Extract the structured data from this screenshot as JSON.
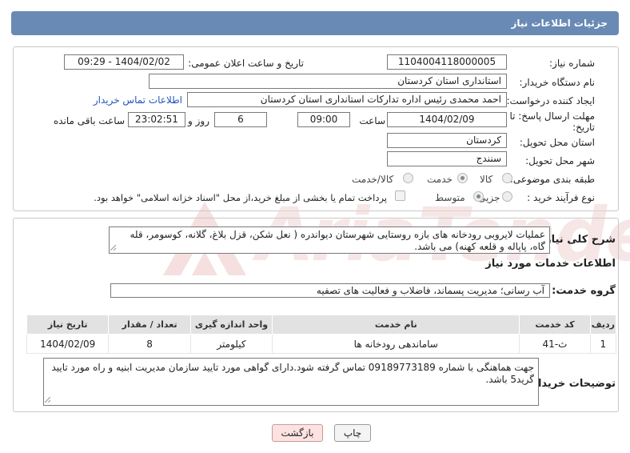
{
  "header": {
    "title": "جزئیات اطلاعات نیاز"
  },
  "watermark": {
    "text": "AriaTender.neT"
  },
  "fields": {
    "need_number_label": "شماره نیاز:",
    "need_number": "1104004118000005",
    "announce_label": "تاریخ و ساعت اعلان عمومی:",
    "announce_value": "1404/02/02 - 09:29",
    "buyer_org_label": "نام دستگاه خریدار:",
    "buyer_org": "استانداری استان کردستان",
    "creator_label": "ایجاد کننده درخواست:",
    "creator": "احمد محمدی رئیس اداره تدارکات استانداری استان کردستان",
    "contact_link": "اطلاعات تماس خریدار",
    "deadline_label_1": "مهلت ارسال پاسخ: تا",
    "deadline_label_2": "تاریخ:",
    "deadline_date": "1404/02/09",
    "time_label": "ساعت",
    "deadline_time": "09:00",
    "days_value": "6",
    "days_label": "روز و",
    "remaining_time": "23:02:51",
    "remaining_label": "ساعت باقی مانده",
    "province_label": "استان محل تحویل:",
    "province": "کردستان",
    "city_label": "شهر محل تحویل:",
    "city": "سنندج",
    "category_label": "طبقه بندی موضوعی:",
    "category_options": [
      "کالا",
      "خدمت",
      "کالا/خدمت"
    ],
    "category_selected": "خدمت",
    "process_label": "نوع فرآیند خرید :",
    "process_options": [
      "جزیی",
      "متوسط"
    ],
    "process_selected": "متوسط",
    "payment_note": "پرداخت تمام یا بخشی از مبلغ خرید،از محل \"اسناد خزانه اسلامی\" خواهد بود."
  },
  "summary": {
    "label": "شرح کلی نیاز:",
    "text": "عملیات لایروبی رودخانه های بازه روستایی شهرستان دیواندره ( نعل شکن، قزل بلاغ، گلانه، کوسومر، قله گاه، پاپاله و قلعه کهنه) می باشد."
  },
  "services_info": {
    "title": "اطلاعات خدمات مورد نیاز",
    "group_label": "گروه خدمت:",
    "group_value": "آب رسانی؛ مدیریت پسماند، فاضلاب و فعالیت های تصفیه"
  },
  "table": {
    "headers": [
      "ردیف",
      "کد خدمت",
      "نام خدمت",
      "واحد اندازه گیری",
      "تعداد / مقدار",
      "تاریخ نیاز"
    ],
    "rows": [
      [
        "1",
        "ث-41",
        "ساماندهی رودخانه ها",
        "کیلومتر",
        "8",
        "1404/02/09"
      ]
    ]
  },
  "buyer_notes": {
    "label": "توضیحات خریدار:",
    "text": "جهت هماهنگی با شماره 09189773189 تماس گرفته شود.دارای گواهی مورد تایید سازمان مدیریت ابنیه و راه مورد تایید گرید5 باشد."
  },
  "buttons": {
    "print": "چاپ",
    "back": "بازگشت"
  },
  "colors": {
    "header_bg": "#6a8ab6",
    "link": "#2255bb",
    "back_button_bg": "#fde2e2"
  }
}
